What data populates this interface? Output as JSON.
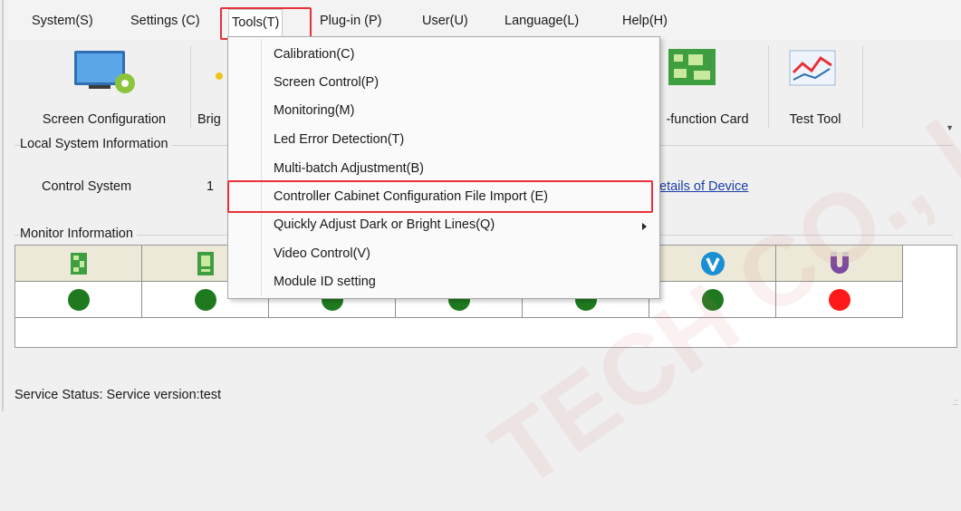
{
  "menubar": {
    "items": [
      "System(S)",
      "Settings (C)",
      "Tools(T)",
      "Plug-in (P)",
      "User(U)",
      "Language(L)",
      "Help(H)"
    ]
  },
  "toolbar": {
    "screen_configuration": "Screen Configuration",
    "brightness_partial": "Brig",
    "multifunction_partial": "-function Card",
    "test_tool": "Test Tool"
  },
  "local_system": {
    "title": "Local System Information",
    "control_system_label": "Control System",
    "control_system_value": "1",
    "details_link": "etails of Device"
  },
  "monitor": {
    "title": "Monitor Information",
    "status_colors": [
      "#1f7a1f",
      "#1f7a1f",
      "#1f7a1f",
      "#1f7a1f",
      "#1f7a1f",
      "#1f7a1f",
      "#ff1a1a"
    ]
  },
  "tools_menu": {
    "items": [
      "Calibration(C)",
      "Screen Control(P)",
      "Monitoring(M)",
      "Led Error Detection(T)",
      "Multi-batch Adjustment(B)",
      "Controller Cabinet Configuration File Import (E)",
      "Quickly Adjust Dark or Bright Lines(Q)",
      "Video Control(V)",
      "Module ID setting"
    ]
  },
  "status_bar": {
    "text": "Service Status:  Service version:test"
  },
  "watermark": {
    "text": "TECH CO., LTD"
  },
  "colors": {
    "highlight_box": "#e8313a",
    "status_ok": "#1f7a1f",
    "status_error": "#ff1a1a",
    "link": "#1a3ea8"
  }
}
